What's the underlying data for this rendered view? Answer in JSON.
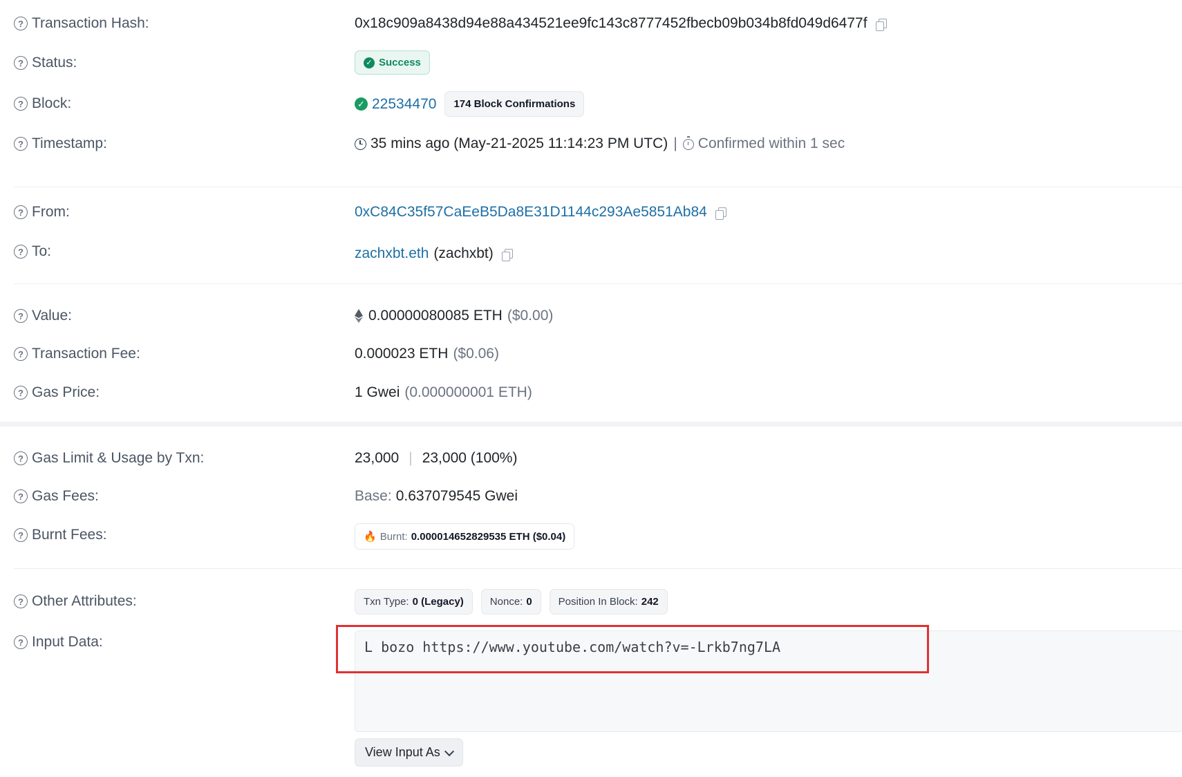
{
  "labels": {
    "tx_hash": "Transaction Hash:",
    "status": "Status:",
    "block": "Block:",
    "timestamp": "Timestamp:",
    "from": "From:",
    "to": "To:",
    "value": "Value:",
    "tx_fee": "Transaction Fee:",
    "gas_price": "Gas Price:",
    "gas_limit": "Gas Limit & Usage by Txn:",
    "gas_fees": "Gas Fees:",
    "burnt_fees": "Burnt Fees:",
    "other_attributes": "Other Attributes:",
    "input_data": "Input Data:"
  },
  "tx": {
    "hash": "0x18c909a8438d94e88a434521ee9fc143c8777452fbecb09b034b8fd049d6477f",
    "status": "Success",
    "block_number": "22534470",
    "block_confirmations": "174 Block Confirmations",
    "timestamp_ago": "35 mins ago (May-21-2025 11:14:23 PM UTC)",
    "timestamp_sep": "|",
    "confirmed_within": "Confirmed within 1 sec",
    "from": "0xC84C35f57CaEeB5Da8E31D1144c293Ae5851Ab84",
    "to_ens": "zachxbt.eth",
    "to_name": "(zachxbt)",
    "value_amount": "0.00000080085 ETH",
    "value_usd": "($0.00)",
    "fee_amount": "0.000023 ETH",
    "fee_usd": "($0.06)",
    "gas_price_amount": "1 Gwei",
    "gas_price_eth": "(0.000000001 ETH)",
    "gas_limit": "23,000",
    "gas_used": "23,000 (100%)",
    "gas_base_label": "Base:",
    "gas_base_value": "0.637079545 Gwei",
    "burnt_label": "Burnt:",
    "burnt_value": "0.000014652829535 ETH ($0.04)",
    "txn_type_label": "Txn Type:",
    "txn_type_value": "0 (Legacy)",
    "nonce_label": "Nonce:",
    "nonce_value": "0",
    "position_label": "Position In Block:",
    "position_value": "242",
    "input_data": "L bozo https://www.youtube.com/watch?v=-Lrkb7ng7LA",
    "view_input_label": "View Input As"
  },
  "icons": {
    "help": "question-circle-icon",
    "copy": "copy-icon",
    "success": "check-circle-icon",
    "clock": "clock-icon",
    "timer": "stopwatch-icon",
    "eth": "ethereum-icon",
    "fire": "fire-icon",
    "chevron": "chevron-down-icon"
  },
  "colors": {
    "link": "#1d6fa5",
    "success": "#0f8a5f",
    "highlight": "#e03131"
  }
}
